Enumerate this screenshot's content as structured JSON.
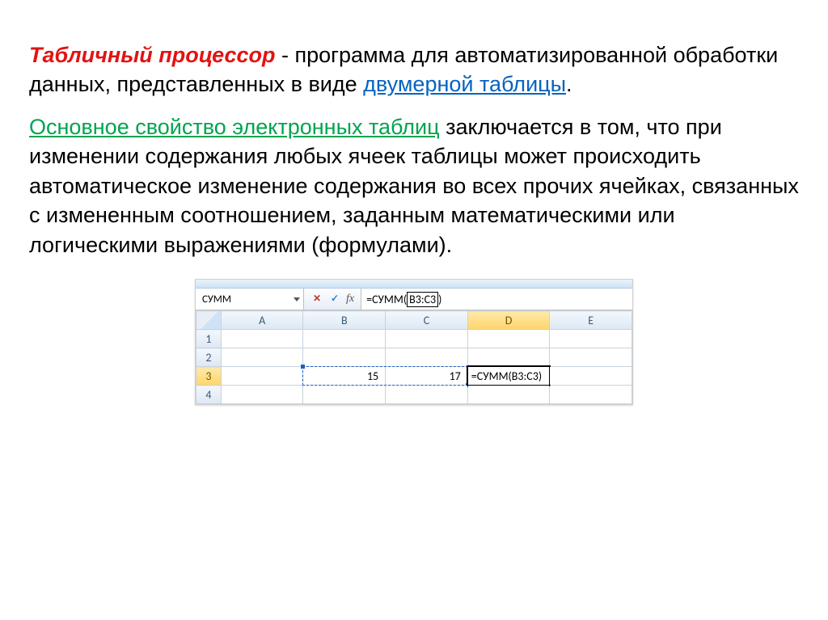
{
  "text": {
    "title_term": "Табличный процессор",
    "p1_rest_a": " - программа для автоматизированной обработки данных, представленных в виде ",
    "p1_blue": "двумерной таблицы",
    "p1_dot": ".",
    "p2_green": "Основное свойство электронных таблиц",
    "p2_rest": " заключается в том, что при изменении содержания любых ячеек таблицы может происходить автоматическое изменение содержания во всех прочих ячейках, связанных с измененным соотношением, заданным математическими или логическими выражениями (формулами)."
  },
  "excel": {
    "name_box": "СУММ",
    "cancel": "✕",
    "check": "✓",
    "fx": "fx",
    "formula": "=СУММ(",
    "formula_arg": "B3:C3",
    "formula_close": ")",
    "cols": [
      "A",
      "B",
      "C",
      "D",
      "E"
    ],
    "rows": [
      "1",
      "2",
      "3",
      "4"
    ],
    "b3": "15",
    "c3": "17",
    "d3": "=СУММ(B3:C3)",
    "active_col": "D",
    "active_row": "3"
  }
}
